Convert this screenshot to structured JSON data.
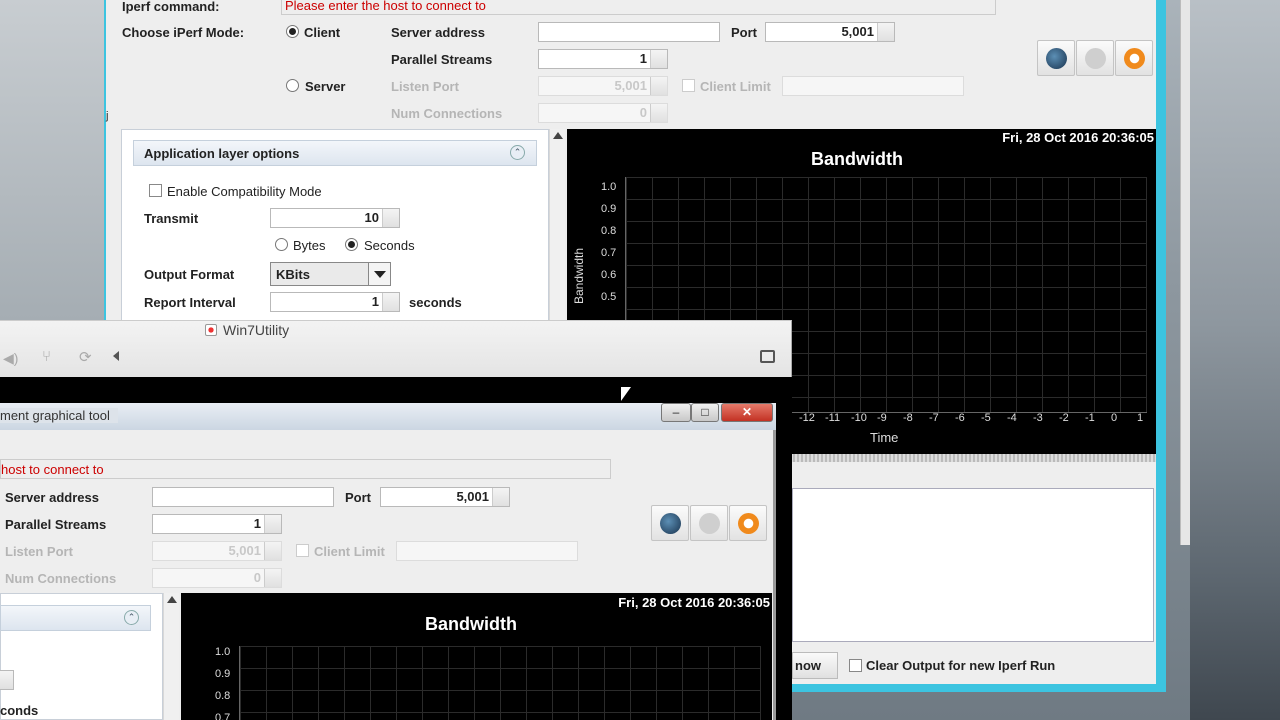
{
  "back": {
    "command_label": "Iperf command:",
    "command_error": "Please enter the host to connect to",
    "mode_label": "Choose iPerf Mode:",
    "client": "Client",
    "server": "Server",
    "server_address": "Server address",
    "port": "Port",
    "port_value": "5,001",
    "parallel": "Parallel Streams",
    "parallel_value": "1",
    "listen_port": "Listen Port",
    "listen_value": "5,001",
    "client_limit": "Client Limit",
    "num_conn": "Num Connections",
    "num_conn_value": "0",
    "app_options": "Application layer options",
    "compat": "Enable Compatibility Mode",
    "transmit": "Transmit",
    "transmit_value": "10",
    "bytes": "Bytes",
    "seconds": "Seconds",
    "output_format": "Output Format",
    "format_value": "KBits",
    "report_interval": "Report Interval",
    "report_value": "1",
    "seconds_unit": "seconds",
    "timestamp": "Fri, 28 Oct 2016 20:36:05",
    "chart_title": "Bandwidth",
    "ylabel": "Bandwidth",
    "xlabel": "Time",
    "yticks": [
      "1.0",
      "0.9",
      "0.8",
      "0.7",
      "0.6",
      "0.5"
    ],
    "xticks": [
      "-12",
      "-11",
      "-10",
      "-9",
      "-8",
      "-7",
      "-6",
      "-5",
      "-4",
      "-3",
      "-2",
      "-1",
      "0",
      "1"
    ],
    "now_btn": "now",
    "clear_output": "Clear Output for new Iperf Run"
  },
  "vm": {
    "title": "Win7Utility"
  },
  "front": {
    "title": "ment graphical tool",
    "error": "host to connect to",
    "server_address": "Server address",
    "port": "Port",
    "port_value": "5,001",
    "parallel": "Parallel Streams",
    "parallel_value": "1",
    "listen_port": "Listen Port",
    "listen_value": "5,001",
    "client_limit": "Client Limit",
    "num_conn": "Num Connections",
    "num_conn_value": "0",
    "timestamp": "Fri, 28 Oct 2016 20:36:05",
    "chart_title": "Bandwidth",
    "yticks": [
      "1.0",
      "0.9",
      "0.8",
      "0.7"
    ],
    "seconds_partial": "conds"
  },
  "colors": {
    "accent_border": "#3cc4e0",
    "error_text": "#cc0000",
    "chart_bg": "#000000"
  }
}
